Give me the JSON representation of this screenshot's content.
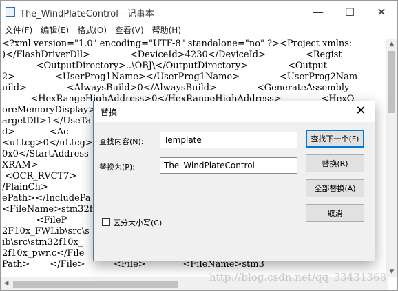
{
  "window": {
    "title": "The_WindPlateControl - 记事本",
    "controls": {
      "minimize": "—",
      "maximize": "☐",
      "close": "✕"
    }
  },
  "menu": {
    "items": [
      "文件(F)",
      "编辑(E)",
      "格式(O)",
      "查看(V)",
      "帮助(H)"
    ]
  },
  "editor": {
    "lines": [
      "<?xml version=\"1.0\" encoding=\"UTF-8\" standalone=\"no\" ?><Project xmlns:",
      ")</FlashDriverDll>              <DeviceId>4230</DeviceId>              <Regist",
      "            <OutputDirectory>..\\OBJ\\</OutputDirectory>              <Output",
      "2>              <UserProg1Name></UserProg1Name>              <UserProg2Nam",
      "uild>              <AlwaysBuild>0</AlwaysBuild>              <GenerateAssembly",
      "          <HexRangeHighAddress>0</HexRangeHighAddress>              <HexO",
      "oreMemoryDisplay>                                                     lTo",
      "argetDll>1</UseTa                                                     ",
      "d>            <Ac",
      "<uLtcg>0</uLtcg>                                                      3</",
      "0x0</StartAddress                                                     cm3",
      "XRAM>",
      " <OCR_RVCT7>                                                          res",
      "/PlainCh>",
      "ePath></IncludePa",
      "<FileName>stm32fl                                                     ype",
      "            <FileP",
      "2F10x_FWLib\\src\\s",
      "ib\\src\\stm32f10x_                                                    Fil",
      "2f10x_pwr.c</File",
      "Path>       </File>          <File>             <FileName>stm3"
    ],
    "watermark": "http://blog.csdn.net/qq_33431368"
  },
  "dialog": {
    "title": "替换",
    "close": "✕",
    "find_label": "查找内容(N):",
    "find_value": "Template",
    "replace_label": "替换为(P):",
    "replace_value": "The_WindPlateControl",
    "match_case_label": "区分大小写(C)",
    "buttons": {
      "find_next": "查找下一个(F)",
      "replace": "替换(R)",
      "replace_all": "全部替换(A)",
      "cancel": "取消"
    }
  },
  "colors": {
    "accent": "#0078d7",
    "dialog_bg": "#f0f0f0"
  }
}
